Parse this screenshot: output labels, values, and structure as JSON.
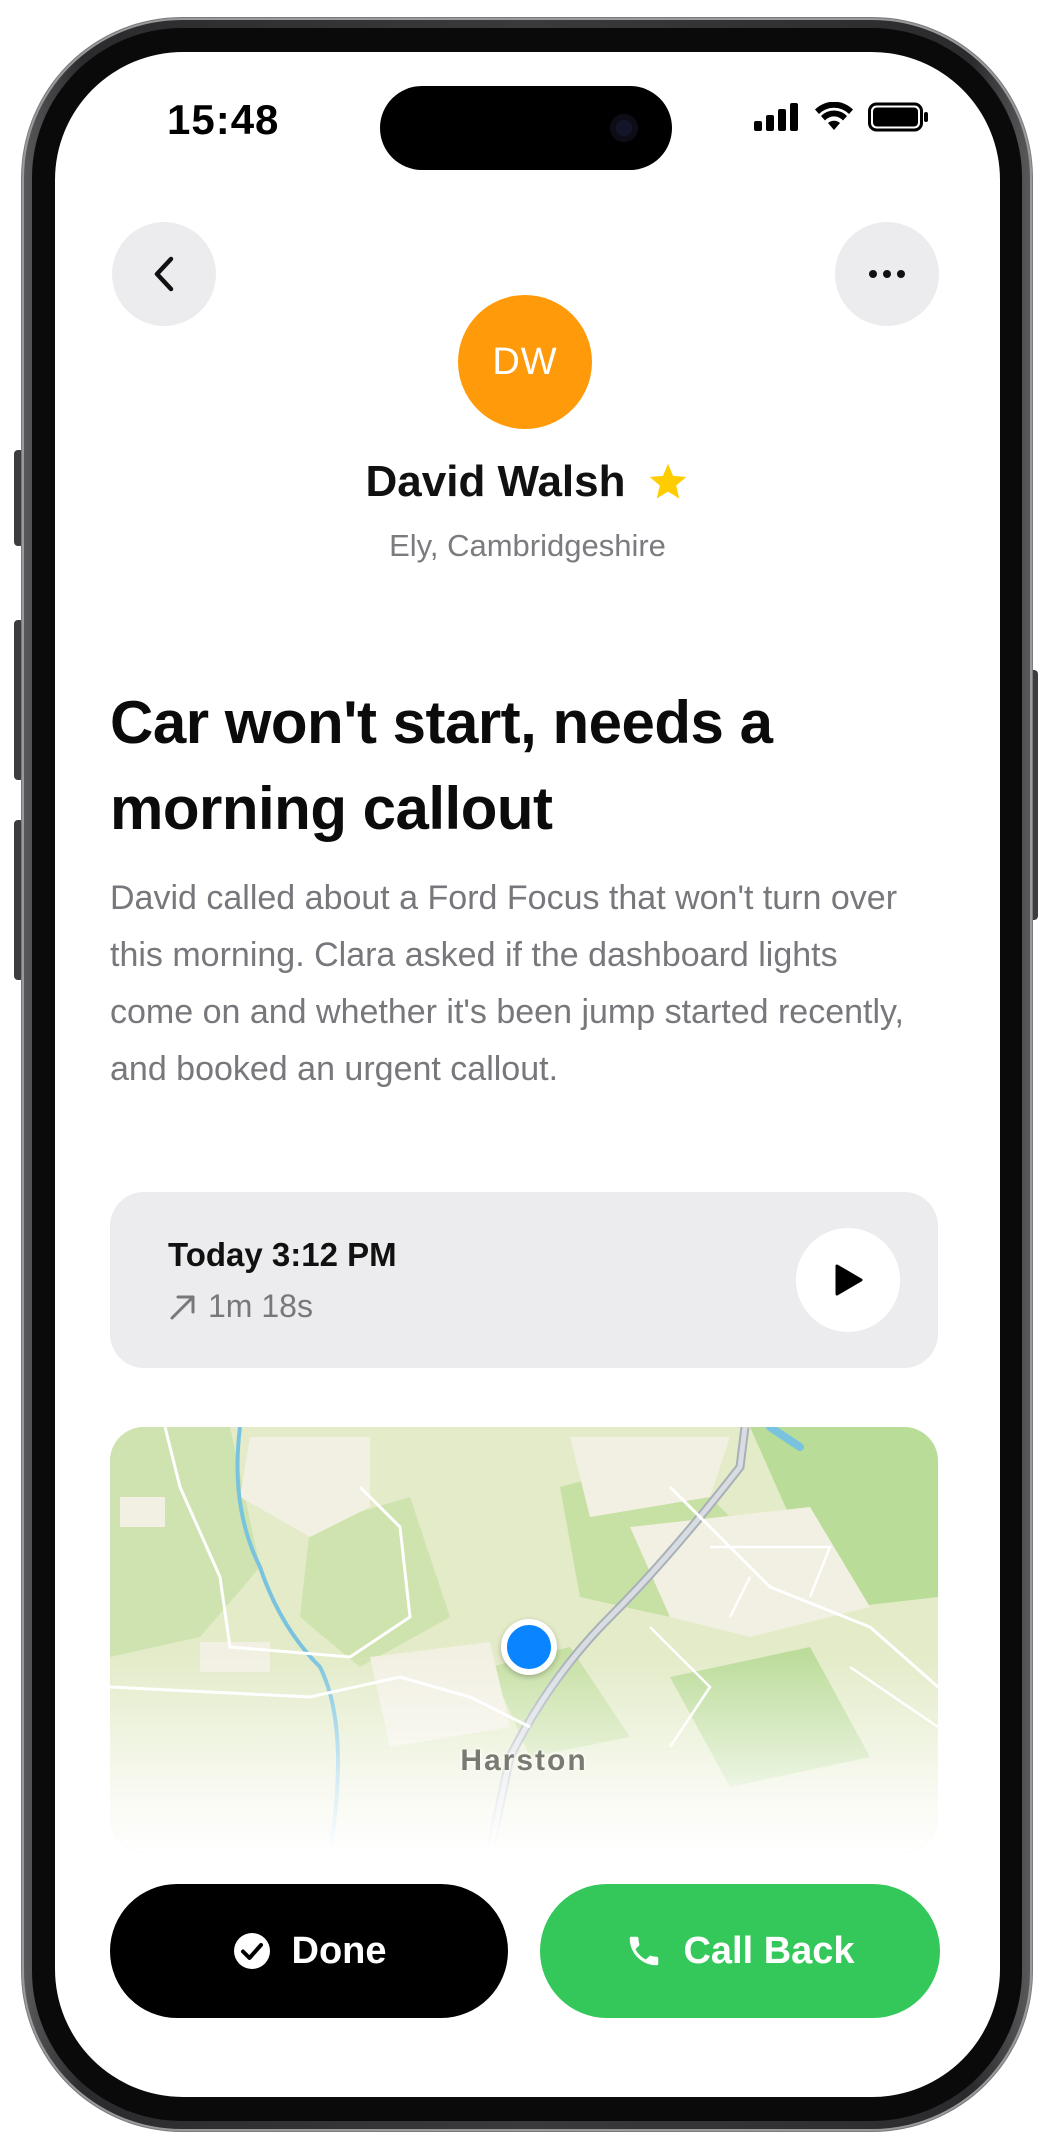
{
  "status_bar": {
    "time": "15:48"
  },
  "contact": {
    "initials": "DW",
    "avatar_color": "#ff9a0a",
    "name": "David Walsh",
    "favorite": true,
    "location": "Ely, Cambridgeshire"
  },
  "summary": {
    "title": "Car won't start, needs a morning callout",
    "description": "David called about a Ford Focus that won't turn over this morning. Clara asked if the dashboard lights come on and whether it's been jump started recently, and booked an urgent callout."
  },
  "call": {
    "when": "Today 3:12 PM",
    "direction_icon": "outgoing-arrow-icon",
    "duration": "1m 18s"
  },
  "map": {
    "place_label": "Harston",
    "pin_color": "#0a84ff"
  },
  "actions": {
    "done_label": "Done",
    "call_back_label": "Call Back",
    "call_back_color": "#34c759"
  }
}
